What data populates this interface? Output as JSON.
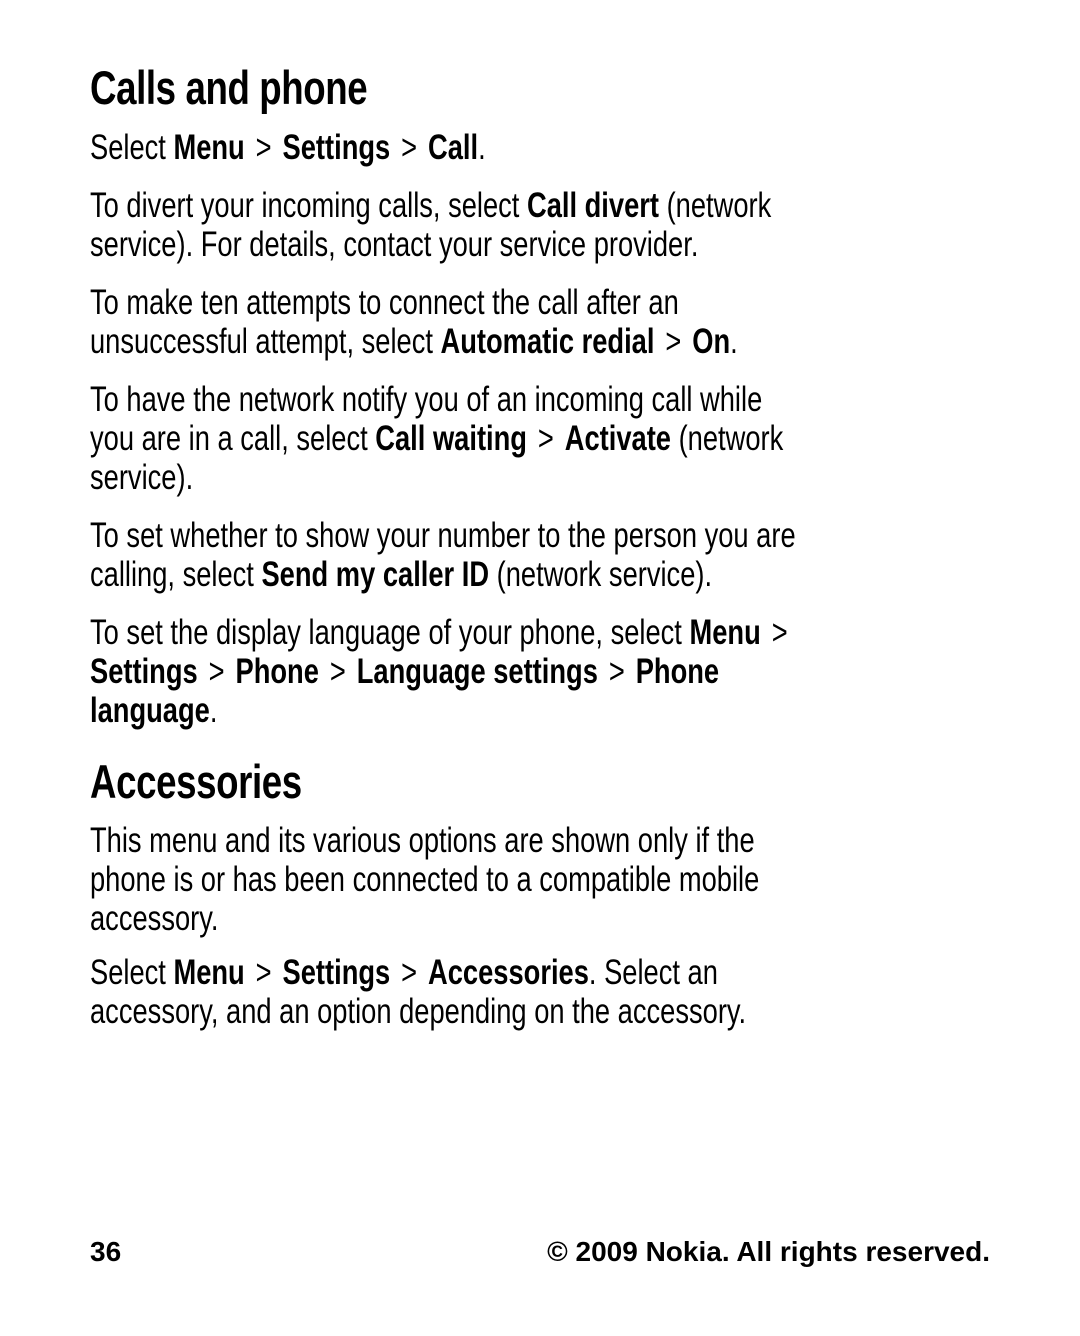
{
  "sections": [
    {
      "title": "Calls and phone",
      "paragraphs": [
        {
          "lines": [
            [
              {
                "t": "Select ",
                "b": false
              },
              {
                "t": "Menu",
                "b": true
              },
              {
                "t": ">",
                "sep": true
              },
              {
                "t": "Settings",
                "b": true
              },
              {
                "t": ">",
                "sep": true
              },
              {
                "t": "Call",
                "b": true
              },
              {
                "t": ".",
                "b": false
              }
            ]
          ]
        },
        {
          "lines": [
            [
              {
                "t": "To divert your incoming calls, select ",
                "b": false
              },
              {
                "t": "Call divert",
                "b": true
              },
              {
                "t": " (network",
                "b": false
              }
            ],
            [
              {
                "t": "service). For details, contact your service provider.",
                "b": false
              }
            ]
          ]
        },
        {
          "lines": [
            [
              {
                "t": "To make ten attempts to connect the call after an",
                "b": false
              }
            ],
            [
              {
                "t": "unsuccessful attempt, select ",
                "b": false
              },
              {
                "t": "Automatic redial",
                "b": true
              },
              {
                "t": ">",
                "sep": true
              },
              {
                "t": "On",
                "b": true
              },
              {
                "t": ".",
                "b": false
              }
            ]
          ]
        },
        {
          "lines": [
            [
              {
                "t": "To have the network notify you of an incoming call while",
                "b": false
              }
            ],
            [
              {
                "t": "you are in a call, select ",
                "b": false
              },
              {
                "t": "Call waiting",
                "b": true
              },
              {
                "t": ">",
                "sep": true
              },
              {
                "t": "Activate",
                "b": true
              },
              {
                "t": " (network",
                "b": false
              }
            ],
            [
              {
                "t": "service).",
                "b": false
              }
            ]
          ]
        },
        {
          "lines": [
            [
              {
                "t": "To set whether to show your number to the person you are",
                "b": false
              }
            ],
            [
              {
                "t": "calling, select ",
                "b": false
              },
              {
                "t": "Send my caller ID",
                "b": true
              },
              {
                "t": " (network service).",
                "b": false
              }
            ]
          ]
        },
        {
          "lines": [
            [
              {
                "t": "To set the display language of your phone, select ",
                "b": false
              },
              {
                "t": "Menu",
                "b": true
              },
              {
                "t": ">",
                "sep": true
              }
            ],
            [
              {
                "t": "Settings",
                "b": true
              },
              {
                "t": ">",
                "sep": true
              },
              {
                "t": "Phone",
                "b": true
              },
              {
                "t": ">",
                "sep": true
              },
              {
                "t": "Language settings",
                "b": true
              },
              {
                "t": ">",
                "sep": true
              },
              {
                "t": "Phone",
                "b": true
              }
            ],
            [
              {
                "t": "language",
                "b": true
              },
              {
                "t": ".",
                "b": false
              }
            ]
          ]
        }
      ]
    },
    {
      "title": "Accessories",
      "paragraphs": [
        {
          "lines": [
            [
              {
                "t": "This menu and its various options are shown only if the",
                "b": false
              }
            ],
            [
              {
                "t": "phone is or has been connected to a compatible mobile",
                "b": false
              }
            ],
            [
              {
                "t": "accessory.",
                "b": false
              }
            ]
          ]
        },
        {
          "lines": [
            [
              {
                "t": "Select ",
                "b": false
              },
              {
                "t": "Menu",
                "b": true
              },
              {
                "t": ">",
                "sep": true
              },
              {
                "t": "Settings",
                "b": true
              },
              {
                "t": ">",
                "sep": true
              },
              {
                "t": "Accessories",
                "b": true
              },
              {
                "t": ". Select an",
                "b": false
              }
            ],
            [
              {
                "t": "accessory, and an option depending on the accessory.",
                "b": false
              }
            ]
          ]
        }
      ]
    }
  ],
  "footer": {
    "page_number": "36",
    "copyright": "© 2009 Nokia. All rights reserved."
  }
}
